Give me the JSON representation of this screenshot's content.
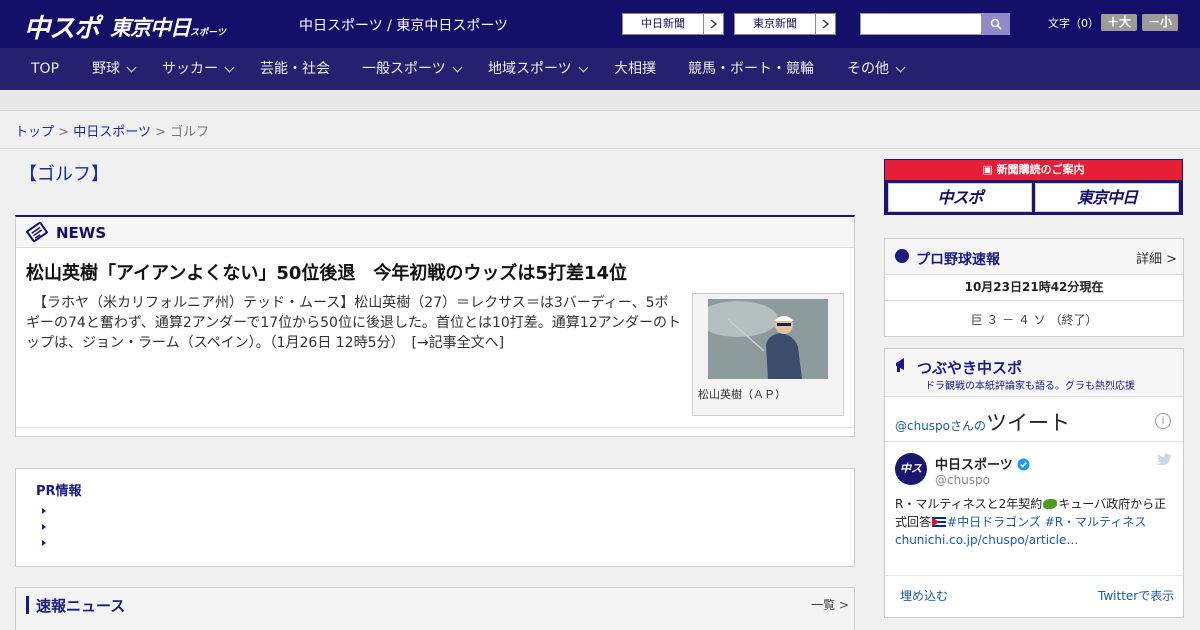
{
  "header": {
    "logo_main": "中スポ",
    "logo_tokyo": "東京中日",
    "logo_tokyo_small": "スポーツ",
    "site_name": "中日スポーツ / 東京中日スポーツ",
    "paper_buttons": [
      "中日新聞",
      "東京新聞"
    ],
    "search_placeholder": "",
    "font_label": "文字（0）",
    "font_bigger": "＋大",
    "font_smaller": "－小"
  },
  "nav": [
    {
      "label": "TOP",
      "dropdown": false
    },
    {
      "label": "野球",
      "dropdown": true
    },
    {
      "label": "サッカー",
      "dropdown": true
    },
    {
      "label": "芸能・社会",
      "dropdown": false
    },
    {
      "label": "一般スポーツ",
      "dropdown": true
    },
    {
      "label": "地域スポーツ",
      "dropdown": true
    },
    {
      "label": "大相撲",
      "dropdown": false
    },
    {
      "label": "競馬・ボート・競輪",
      "dropdown": false
    },
    {
      "label": "その他",
      "dropdown": true
    }
  ],
  "breadcrumb": {
    "home": "トップ",
    "sep": ">",
    "section": "中日スポーツ",
    "current": "ゴルフ"
  },
  "category_title": "【ゴルフ】",
  "news": {
    "label": "NEWS",
    "headline": "松山英樹「アイアンよくない」50位後退　今年初戦のウッズは5打差14位",
    "body": "　【ラホヤ（米カリフォルニア州）テッド・ムース】松山英樹（27）＝レクサス＝は3バーディー、5ボギーの74と奮わず、通算2アンダーで17位から50位に後退した。首位とは10打差。通算12アンダーのトップは、ジョン・ラーム（スペイン）。（1月26日 12時5分）　[→記事全文へ]",
    "photo_caption": "松山英樹（ＡＰ）"
  },
  "pr": {
    "title": "PR情報"
  },
  "sokuho": {
    "title": "速報ニュース",
    "more": "一覧 >"
  },
  "subscribe": {
    "banner": "新聞購読のご案内",
    "logo1": "中スポ",
    "logo2": "東京中日"
  },
  "baseball": {
    "title": "プロ野球速報",
    "detail": "詳細 >",
    "timestamp": "10月23日21時42分現在",
    "score": "巨 ３ － ４ ソ （終了）"
  },
  "tsubuyaki": {
    "title": "つぶやき中スポ",
    "subtitle": "ドラ観戦の本紙評論家も語る。グラも熱烈応援",
    "handle_prefix": "@chuspo",
    "handle_suffix": "さんの",
    "tweet_label": "ツイート",
    "account_name": "中日スポーツ",
    "account_handle": "@chuspo",
    "avatar_text": "中スポ",
    "tweet_line1": "R・マルティネスと2年契約",
    "tweet_line2": "キューバ政府から正式回答",
    "tweet_tags": "#中日ドラゴンズ #R・マルティネス",
    "tweet_link": "chunichi.co.jp/chuspo/article…",
    "embed": "埋め込む",
    "view_on_twitter": "Twitterで表示"
  },
  "colors": {
    "header_bg": "#14106a",
    "nav_bg": "#26216f",
    "accent_red": "#e61e36",
    "link_blue": "#1d2aa8"
  }
}
